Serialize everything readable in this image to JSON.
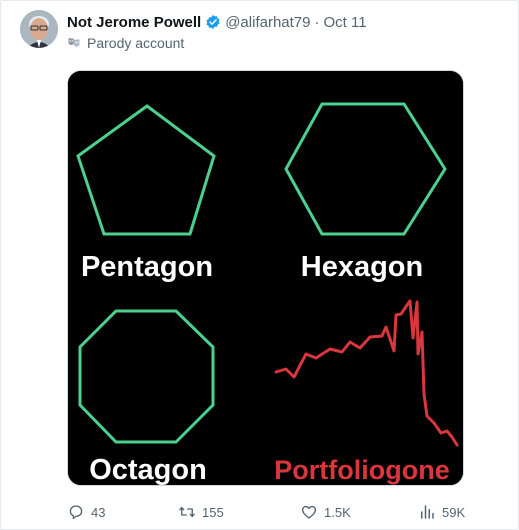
{
  "tweet": {
    "display_name": "Not Jerome Powell",
    "handle": "@alifarhat79",
    "separator": "·",
    "date": "Oct 11",
    "account_label": "Parody account",
    "icons": {
      "avatar": "avatar-image",
      "verified": "verified-badge-icon",
      "account_label": "theater-mask-icon"
    }
  },
  "media": {
    "labels": {
      "pentagon": "Pentagon",
      "hexagon": "Hexagon",
      "octagon": "Octagon",
      "portfolio": "Portfoliogone"
    },
    "colors": {
      "background": "#000000",
      "shape_stroke": "#4bd18f",
      "label": "#ffffff",
      "portfolio": "#d9363e"
    }
  },
  "actions": {
    "reply_count": "43",
    "retweet_count": "155",
    "like_count": "1.5K",
    "views_count": "59K",
    "icons": [
      "reply-icon",
      "retweet-icon",
      "like-icon",
      "views-icon"
    ]
  },
  "colors": {
    "text_primary": "#0f1419",
    "text_secondary": "#536471",
    "verified": "#1d9bf0"
  }
}
